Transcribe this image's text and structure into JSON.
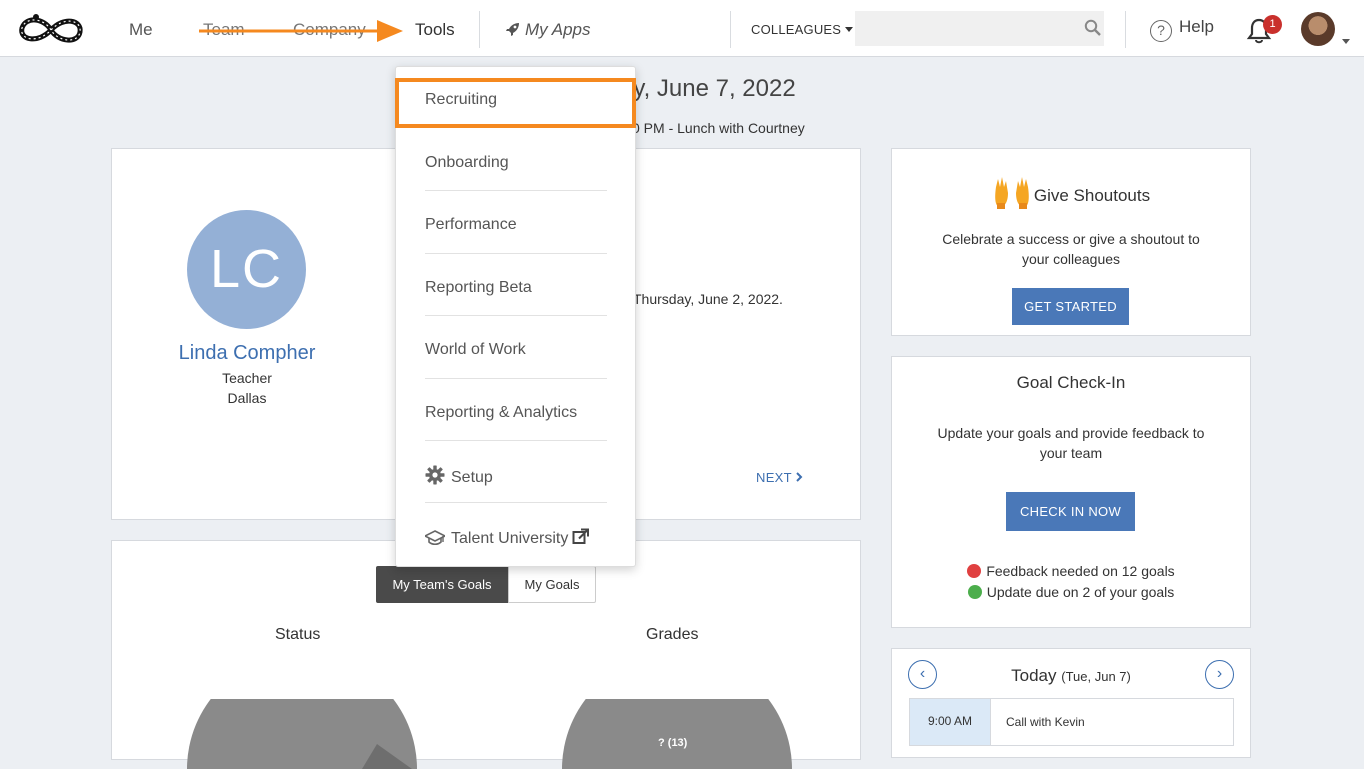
{
  "nav": {
    "me": "Me",
    "team": "Team",
    "company": "Company",
    "tools": "Tools",
    "my_apps": "My Apps",
    "colleagues": "COLLEAGUES",
    "search_placeholder": "",
    "help": "Help",
    "notification_count": "1",
    "accent_color": "#f5891f"
  },
  "page": {
    "date_heading": "ay, June 7, 2022",
    "event_line": "0 PM - Lunch with Courtney"
  },
  "profile": {
    "initials": "LC",
    "name": "Linda Compher",
    "title": "Teacher",
    "location": "Dallas",
    "notice": "Thursday, June 2, 2022.",
    "next": "NEXT"
  },
  "goals": {
    "tab_active": "My Team's Goals",
    "tab_inactive": "My Goals",
    "status_label": "Status",
    "grades_label": "Grades",
    "grades_pie_label": "? (13)"
  },
  "shoutouts": {
    "title": "Give Shoutouts",
    "text": "Celebrate a success or give a shoutout to your colleagues",
    "button": "GET STARTED"
  },
  "checkin": {
    "title": "Goal Check-In",
    "text": "Update your goals and provide feedback to your team",
    "button": "CHECK IN NOW",
    "feedback_needed": "Feedback needed on 12 goals",
    "update_due": "Update due on 2 of your goals",
    "red": "#e04040",
    "green": "#4cae4c"
  },
  "calendar": {
    "title": "Today",
    "date": "(Tue, Jun 7)",
    "events": [
      {
        "time": "9:00 AM",
        "title": "Call with Kevin"
      }
    ]
  },
  "tools_menu": {
    "items": [
      "Recruiting",
      "Onboarding",
      "Performance",
      "Reporting Beta",
      "World of Work",
      "Reporting & Analytics",
      "Setup",
      "Talent University"
    ],
    "highlighted": "Recruiting"
  }
}
